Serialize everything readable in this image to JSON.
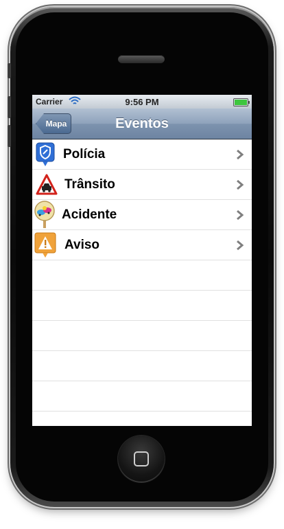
{
  "status_bar": {
    "carrier": "Carrier",
    "time": "9:56 PM"
  },
  "nav": {
    "title": "Eventos",
    "back_label": "Mapa"
  },
  "events": [
    {
      "label": "Polícia",
      "icon": "police-shield-icon"
    },
    {
      "label": "Trânsito",
      "icon": "traffic-warning-icon"
    },
    {
      "label": "Acidente",
      "icon": "accident-pin-icon"
    },
    {
      "label": "Aviso",
      "icon": "warning-icon"
    }
  ],
  "colors": {
    "nav_bar": "#8ea2bb",
    "battery": "#3ec63e"
  }
}
